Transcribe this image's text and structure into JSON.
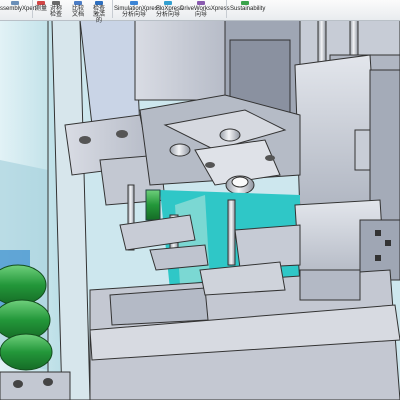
{
  "ribbon": {
    "items": [
      {
        "label": "ssemblyXpert",
        "icon": "assembly-xpert-icon",
        "color": "#6b8fb8"
      },
      {
        "label": "测量",
        "icon": "measure-icon",
        "color": "#d24545"
      },
      {
        "label": "对称检查",
        "icon": "symmetry-check-icon",
        "color": "#6a6a6a"
      },
      {
        "label": "比较文档",
        "icon": "compare-documents-icon",
        "color": "#4b7cc5"
      },
      {
        "label": "检查激活的",
        "icon": "check-active-icon",
        "color": "#2e6fbf"
      },
      {
        "label": "SimulationXpress 分析向导",
        "icon": "simulation-xpress-icon",
        "color": "#3b84d6"
      },
      {
        "label": "FloXpress 分析向导",
        "icon": "floxpress-icon",
        "color": "#34a0d0"
      },
      {
        "label": "DriveWorksXpress 向导",
        "icon": "driveworks-xpress-icon",
        "color": "#8a5bb0"
      },
      {
        "label": "Sustainability",
        "icon": "sustainability-icon",
        "color": "#3aa34b"
      }
    ]
  },
  "colors": {
    "part_gray": "#c8ccd6",
    "glass_blue": "#bcdfe7",
    "green_part": "#2fa84a",
    "teal": "#2fc7c7",
    "background": "#cfe6ee"
  }
}
